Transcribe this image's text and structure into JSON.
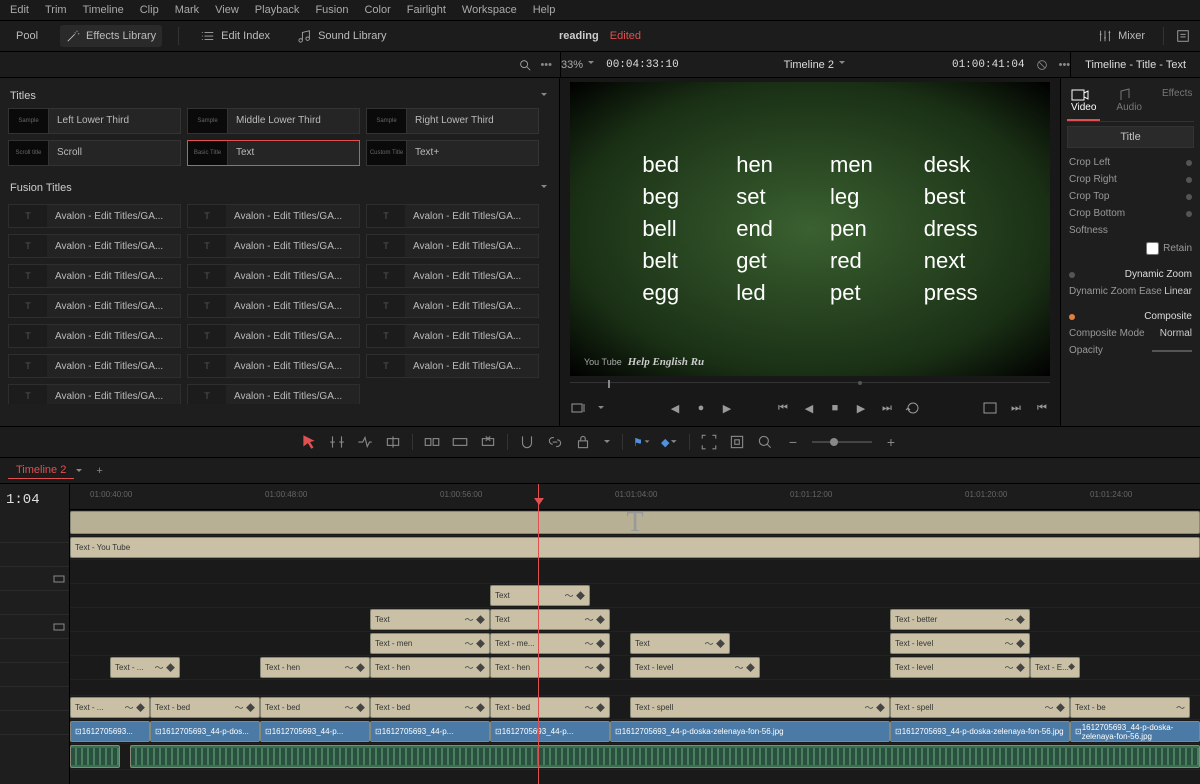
{
  "menu": [
    "Edit",
    "Trim",
    "Timeline",
    "Clip",
    "Mark",
    "View",
    "Playback",
    "Fusion",
    "Color",
    "Fairlight",
    "Workspace",
    "Help"
  ],
  "toolbar": {
    "pool": "Pool",
    "effects": "Effects Library",
    "editIndex": "Edit Index",
    "soundLib": "Sound Library",
    "mixer": "Mixer"
  },
  "project": {
    "name": "reading",
    "status": "Edited"
  },
  "viewerBar": {
    "zoom": "33%",
    "sourceTC": "00:04:33:10",
    "timelineName": "Timeline 2",
    "recordTC": "01:00:41:04"
  },
  "inspector": {
    "title": "Timeline - Title - Text",
    "tabs": {
      "video": "Video",
      "audio": "Audio",
      "effects": "Effects"
    },
    "controlTitle": "Title",
    "rows": {
      "cropLeft": "Crop Left",
      "cropRight": "Crop Right",
      "cropTop": "Crop Top",
      "cropBottom": "Crop Bottom",
      "softness": "Softness",
      "retain": "Retain",
      "dynZoom": "Dynamic Zoom",
      "dynEase": "Dynamic Zoom Ease",
      "dynEaseVal": "Linear",
      "composite": "Composite",
      "compMode": "Composite Mode",
      "compModeVal": "Normal",
      "opacity": "Opacity"
    }
  },
  "titles": {
    "header": "Titles",
    "items": [
      {
        "thumb": "Sample",
        "label": "Left Lower Third"
      },
      {
        "thumb": "Sample",
        "label": "Middle Lower Third"
      },
      {
        "thumb": "Sample",
        "label": "Right Lower Third"
      },
      {
        "thumb": "Scroll title",
        "label": "Scroll"
      },
      {
        "thumb": "Basic Title",
        "label": "Text",
        "selected": true
      },
      {
        "thumb": "Custom Title",
        "label": "Text+"
      }
    ],
    "fusionHeader": "Fusion Titles",
    "fusion": [
      "Avalon - Edit Titles/GA...",
      "Avalon - Edit Titles/GA...",
      "Avalon - Edit Titles/GA...",
      "Avalon - Edit Titles/GA...",
      "Avalon - Edit Titles/GA...",
      "Avalon - Edit Titles/GA...",
      "Avalon - Edit Titles/GA...",
      "Avalon - Edit Titles/GA...",
      "Avalon - Edit Titles/GA...",
      "Avalon - Edit Titles/GA...",
      "Avalon - Edit Titles/GA...",
      "Avalon - Edit Titles/GA...",
      "Avalon - Edit Titles/GA...",
      "Avalon - Edit Titles/GA...",
      "Avalon - Edit Titles/GA...",
      "Avalon - Edit Titles/GA...",
      "Avalon - Edit Titles/GA...",
      "Avalon - Edit Titles/GA...",
      "Avalon - Edit Titles/GA...",
      "Avalon - Edit Titles/GA..."
    ]
  },
  "viewer": {
    "words": [
      "bed",
      "hen",
      "men",
      "desk",
      "beg",
      "set",
      "leg",
      "best",
      "bell",
      "end",
      "pen",
      "dress",
      "belt",
      "get",
      "red",
      "next",
      "egg",
      "led",
      "pet",
      "press"
    ],
    "captionPrefix": "You Tube",
    "caption": "Help English Ru"
  },
  "timeline": {
    "tab": "Timeline 2",
    "tc": "1:04",
    "ruler": [
      "01:00:40:00",
      "01:00:48:00",
      "01:00:56:00",
      "01:01:04:00",
      "01:01:12:00",
      "01:01:20:00",
      "01:01:24:00"
    ],
    "clips": {
      "t1": "Text - You Tube",
      "textPlain": "Text",
      "textMen": "Text - men",
      "textHen": "Text - hen",
      "textBed": "Text - bed",
      "textMe": "Text - me...",
      "textBetter": "Text - better",
      "textLevel": "Text - level",
      "textSpell": "Text - spell",
      "textBe": "Text - be",
      "textE": "Text - E...",
      "textTen": "Text - ...",
      "video": "1612705693_44-p-doska-zelenaya-fon-56.jpg",
      "videoShort": "1612705693...",
      "videoMed": "1612705693_44-p-dos...",
      "videoMed2": "1612705693_44-p..."
    }
  }
}
